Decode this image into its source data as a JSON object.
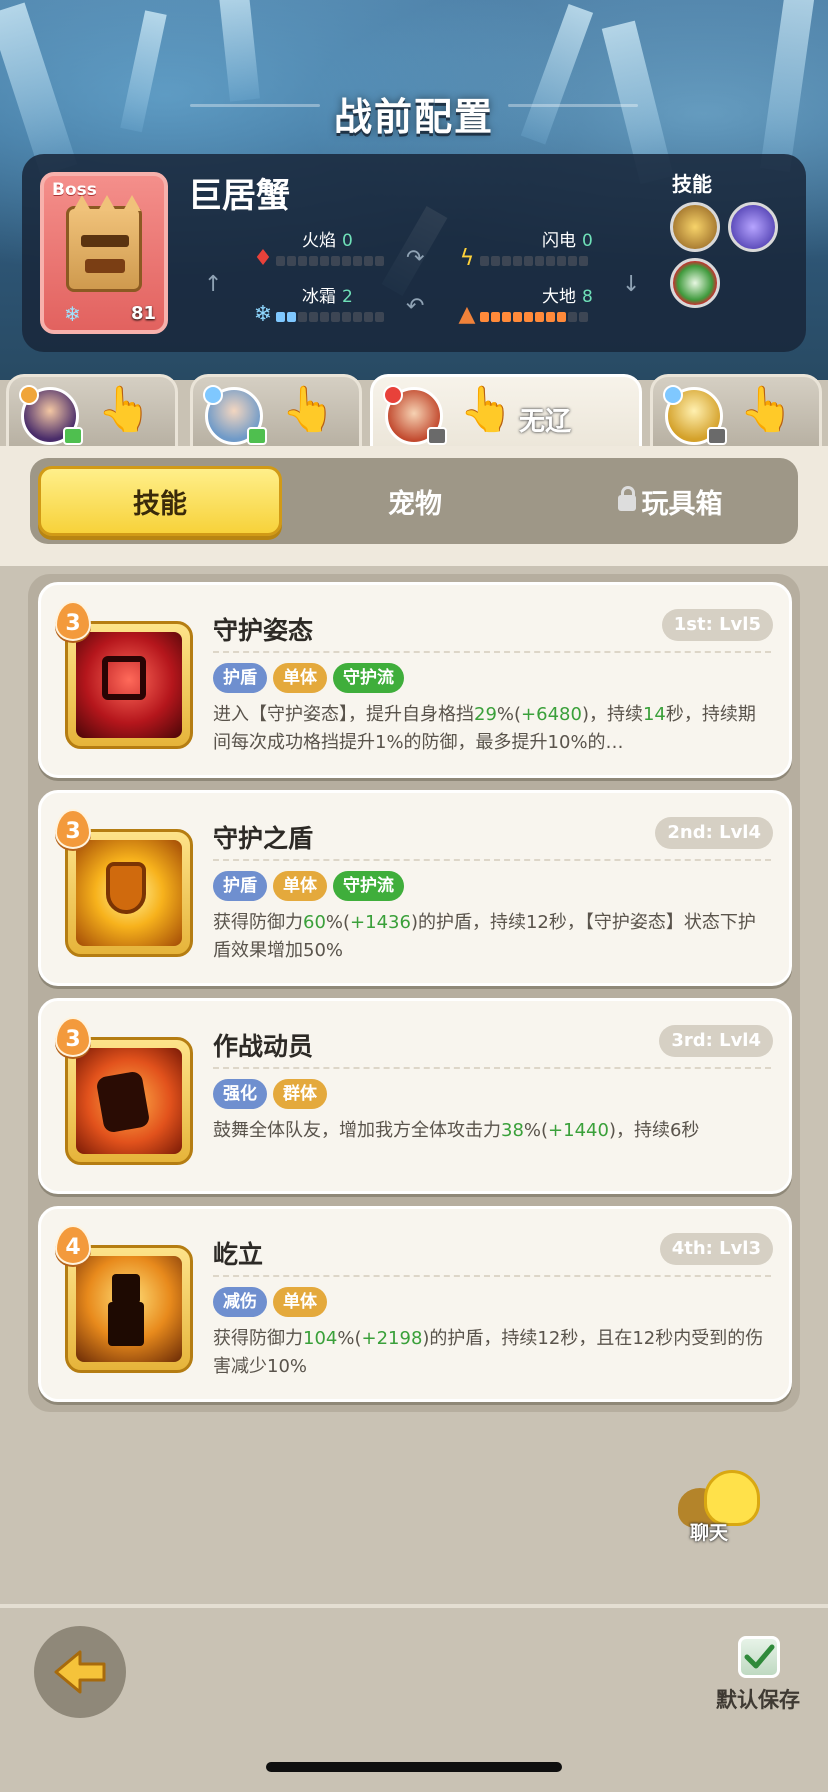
{
  "page": {
    "title": "战前配置"
  },
  "boss": {
    "tag": "Boss",
    "name": "巨居蟹",
    "level": "81",
    "stats": {
      "fire": {
        "label": "火焰",
        "value": "0",
        "filled": 0
      },
      "lightning": {
        "label": "闪电",
        "value": "0",
        "filled": 0
      },
      "frost": {
        "label": "冰霜",
        "value": "2",
        "filled": 2
      },
      "earth": {
        "label": "大地",
        "value": "8",
        "filled": 8
      }
    },
    "skills_label": "技能",
    "skill_icons": [
      "boss-skill-earth-icon",
      "boss-skill-vortex-icon",
      "boss-skill-leaf-icon"
    ]
  },
  "heroes": [
    {
      "name": "",
      "active": false
    },
    {
      "name": "",
      "active": false
    },
    {
      "name": "无辽",
      "active": true
    },
    {
      "name": "",
      "active": false
    }
  ],
  "segments": {
    "skills": "技能",
    "pets": "宠物",
    "toybox": "玩具箱",
    "active": "skills"
  },
  "skills": [
    {
      "rank": "3",
      "title": "守护姿态",
      "level": "1st: Lvl5",
      "tags": [
        {
          "label": "护盾",
          "color": "#6f8fcf"
        },
        {
          "label": "单体",
          "color": "#e4a93c"
        },
        {
          "label": "守护流",
          "color": "#3fae3b"
        }
      ],
      "desc_pre": "进入【守护姿态】，提升自身格挡",
      "desc_pct": "29",
      "desc_mid": "%(",
      "desc_bonus": "+6480",
      "desc_post_a": ")，持续",
      "desc_dur": "14",
      "desc_post_b": "秒，持续期间每次成功格挡提升1%的防御，最多提升10%的…"
    },
    {
      "rank": "3",
      "title": "守护之盾",
      "level": "2nd: Lvl4",
      "tags": [
        {
          "label": "护盾",
          "color": "#6f8fcf"
        },
        {
          "label": "单体",
          "color": "#e4a93c"
        },
        {
          "label": "守护流",
          "color": "#3fae3b"
        }
      ],
      "desc_pre": "获得防御力",
      "desc_pct": "60",
      "desc_mid": "%(",
      "desc_bonus": "+1436",
      "desc_post_a": ")的护盾，持续12秒，【守护姿态】状态下护盾效果增加50%",
      "desc_dur": "",
      "desc_post_b": ""
    },
    {
      "rank": "3",
      "title": "作战动员",
      "level": "3rd: Lvl4",
      "tags": [
        {
          "label": "强化",
          "color": "#6f8fcf"
        },
        {
          "label": "群体",
          "color": "#e4a93c"
        }
      ],
      "desc_pre": "鼓舞全体队友，增加我方全体攻击力",
      "desc_pct": "38",
      "desc_mid": "%(",
      "desc_bonus": "+1440",
      "desc_post_a": ")，持续6秒",
      "desc_dur": "",
      "desc_post_b": ""
    },
    {
      "rank": "4",
      "title": "屹立",
      "level": "4th: Lvl3",
      "tags": [
        {
          "label": "减伤",
          "color": "#6f8fcf"
        },
        {
          "label": "单体",
          "color": "#e4a93c"
        }
      ],
      "desc_pre": "获得防御力",
      "desc_pct": "104",
      "desc_mid": "%(",
      "desc_bonus": "+2198",
      "desc_post_a": ")的护盾，持续12秒，且在12秒内受到的伤害减少10%",
      "desc_dur": "",
      "desc_post_b": ""
    }
  ],
  "chat": {
    "label": "聊天"
  },
  "footer": {
    "save_label": "默认保存"
  }
}
